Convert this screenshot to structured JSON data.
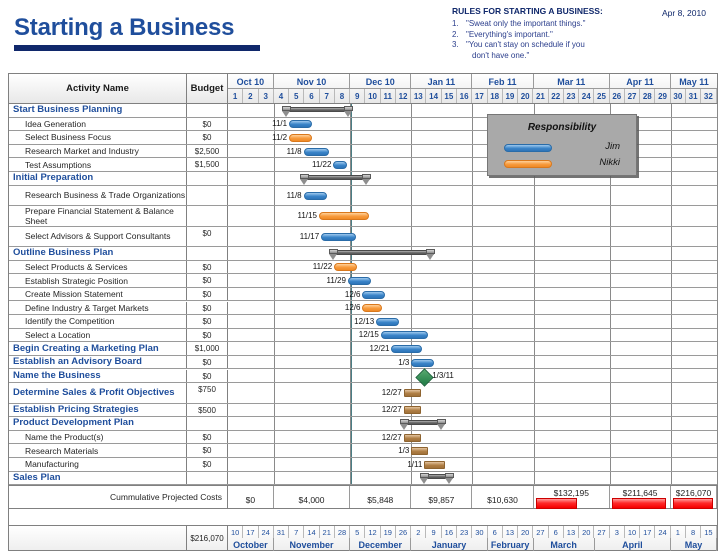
{
  "header": {
    "title": "Starting a Business",
    "date": "Apr 8, 2010",
    "rules_title": "RULES FOR STARTING A BUSINESS:",
    "rules": [
      {
        "num": "1.",
        "text": "\"Sweat only the important things.\"",
        "cont": ""
      },
      {
        "num": "2.",
        "text": "\"Everything's important.\"",
        "cont": ""
      },
      {
        "num": "3.",
        "text": "\"You can't stay on schedule if you",
        "cont": "don't have one.\""
      }
    ]
  },
  "columns": {
    "activity": "Activity Name",
    "budget": "Budget"
  },
  "timeline": {
    "months": [
      {
        "label": "Oct 10",
        "weeks": 3
      },
      {
        "label": "Nov 10",
        "weeks": 5
      },
      {
        "label": "Dec 10",
        "weeks": 4
      },
      {
        "label": "Jan 11",
        "weeks": 4
      },
      {
        "label": "Feb 11",
        "weeks": 4
      },
      {
        "label": "Mar 11",
        "weeks": 5
      },
      {
        "label": "Apr 11",
        "weeks": 4
      },
      {
        "label": "May 11",
        "weeks": 3
      }
    ],
    "week_numbers": [
      "1",
      "2",
      "3",
      "4",
      "5",
      "6",
      "7",
      "8",
      "9",
      "10",
      "11",
      "12",
      "13",
      "14",
      "15",
      "16",
      "17",
      "18",
      "19",
      "20",
      "21",
      "22",
      "23",
      "24",
      "25",
      "26",
      "27",
      "28",
      "29",
      "30",
      "31",
      "32"
    ]
  },
  "legend": {
    "title": "Responsibility",
    "items": [
      {
        "name": "Jim",
        "color": "#3a84c8",
        "key": "jim"
      },
      {
        "name": "Nikki",
        "color": "#f79a3c",
        "key": "nikki"
      }
    ]
  },
  "rows": [
    {
      "name": "Start Business Planning",
      "budget": "",
      "bold": true,
      "type": "summary",
      "start": 3.6,
      "end": 8.1
    },
    {
      "name": "Idea Generation",
      "budget": "$0",
      "bold": false,
      "type": "bar",
      "who": "jim",
      "label": "11/1",
      "start": 4.0,
      "end": 5.5
    },
    {
      "name": "Select Business Focus",
      "budget": "$0",
      "bold": false,
      "type": "bar",
      "who": "nikki",
      "label": "11/2",
      "start": 4.0,
      "end": 5.5
    },
    {
      "name": "Research Market and Industry",
      "budget": "$2,500",
      "bold": false,
      "type": "bar",
      "who": "jim",
      "label": "11/8",
      "start": 4.95,
      "end": 6.6
    },
    {
      "name": "Test Assumptions",
      "budget": "$1,500",
      "bold": false,
      "type": "bar",
      "who": "jim",
      "label": "11/22",
      "start": 6.9,
      "end": 7.8
    },
    {
      "name": "Initial Preparation",
      "budget": "",
      "bold": true,
      "type": "summary",
      "start": 4.75,
      "end": 9.3
    },
    {
      "name": "Research Business & Trade Organizations",
      "budget": "",
      "bold": false,
      "type": "bar",
      "who": "jim",
      "label": "11/8",
      "start": 4.95,
      "end": 6.5
    },
    {
      "name": "Prepare Financial Statement & Balance Sheet",
      "budget": "",
      "bold": false,
      "type": "bar",
      "who": "nikki",
      "label": "11/15",
      "start": 5.95,
      "end": 9.2
    },
    {
      "name": "Select Advisors & Support Consultants",
      "budget": "$0",
      "bold": false,
      "type": "bar",
      "who": "jim",
      "label": "11/17",
      "start": 6.1,
      "end": 8.35
    },
    {
      "name": "Outline Business Plan",
      "budget": "",
      "bold": true,
      "type": "summary",
      "start": 6.7,
      "end": 13.5
    },
    {
      "name": "Select Products & Services",
      "budget": "$0",
      "bold": false,
      "type": "bar",
      "who": "nikki",
      "label": "11/22",
      "start": 6.95,
      "end": 8.45
    },
    {
      "name": "Establish Strategic Position",
      "budget": "$0",
      "bold": false,
      "type": "bar",
      "who": "jim",
      "label": "11/29",
      "start": 7.85,
      "end": 9.35
    },
    {
      "name": "Create Mission Statement",
      "budget": "$0",
      "bold": false,
      "type": "bar",
      "who": "jim",
      "label": "12/6",
      "start": 8.8,
      "end": 10.3
    },
    {
      "name": "Define Industry & Target Markets",
      "budget": "$0",
      "bold": false,
      "type": "bar",
      "who": "nikki",
      "label": "12/6",
      "start": 8.8,
      "end": 10.1
    },
    {
      "name": "Identify the Competition",
      "budget": "$0",
      "bold": false,
      "type": "bar",
      "who": "jim",
      "label": "12/13",
      "start": 9.7,
      "end": 11.2
    },
    {
      "name": "Select a Location",
      "budget": "$0",
      "bold": false,
      "type": "bar",
      "who": "jim",
      "label": "12/15",
      "start": 10.0,
      "end": 13.1
    },
    {
      "name": "Begin Creating a Marketing Plan",
      "budget": "$1,000",
      "bold": true,
      "type": "bar",
      "who": "jim",
      "label": "12/21",
      "start": 10.7,
      "end": 12.7
    },
    {
      "name": "Establish an Advisory Board",
      "budget": "$0",
      "bold": true,
      "type": "bar",
      "who": "jim",
      "label": "1/3",
      "start": 12.0,
      "end": 13.5
    },
    {
      "name": "Name the Business",
      "budget": "$0",
      "bold": true,
      "type": "milestone",
      "label": "1/3/11",
      "start": 12.45
    },
    {
      "name": "Determine Sales & Profit Objectives",
      "budget": "$750",
      "bold": true,
      "type": "bar",
      "who": "none",
      "label": "12/27",
      "start": 11.5,
      "end": 12.6
    },
    {
      "name": "Establish Pricing Strategies",
      "budget": "$500",
      "bold": true,
      "type": "bar",
      "who": "none",
      "label": "12/27",
      "start": 11.5,
      "end": 12.6
    },
    {
      "name": "Product Development Plan",
      "budget": "",
      "bold": true,
      "type": "summary",
      "start": 11.3,
      "end": 14.2
    },
    {
      "name": "Name the Product(s)",
      "budget": "$0",
      "bold": false,
      "type": "bar",
      "who": "none",
      "label": "12/27",
      "start": 11.5,
      "end": 12.6
    },
    {
      "name": "Research Materials",
      "budget": "$0",
      "bold": false,
      "type": "bar",
      "who": "none",
      "label": "1/3",
      "start": 12.0,
      "end": 13.1
    },
    {
      "name": "Manufacturing",
      "budget": "$0",
      "bold": false,
      "type": "bar",
      "who": "none",
      "label": "1/11",
      "start": 12.85,
      "end": 14.2
    },
    {
      "name": "Sales Plan",
      "budget": "",
      "bold": true,
      "type": "summary",
      "start": 12.65,
      "end": 14.7
    }
  ],
  "costs": {
    "label": "Cummulative Projected Costs",
    "total": "$216,070",
    "values": [
      {
        "amount": "$0",
        "bar": false,
        "bar_pct": 0
      },
      {
        "amount": "$4,000",
        "bar": false,
        "bar_pct": 0
      },
      {
        "amount": "$5,848",
        "bar": false,
        "bar_pct": 0
      },
      {
        "amount": "$9,857",
        "bar": false,
        "bar_pct": 0
      },
      {
        "amount": "$10,630",
        "bar": false,
        "bar_pct": 0
      },
      {
        "amount": "$132,195",
        "bar": true,
        "bar_pct": 61
      },
      {
        "amount": "$211,645",
        "bar": true,
        "bar_pct": 98
      },
      {
        "amount": "$216,070",
        "bar": true,
        "bar_pct": 100
      }
    ]
  },
  "footer": {
    "total": "$216,070",
    "week_days": [
      "10",
      "17",
      "24",
      "31",
      "7",
      "14",
      "21",
      "28",
      "5",
      "12",
      "19",
      "26",
      "2",
      "9",
      "16",
      "23",
      "30",
      "6",
      "13",
      "20",
      "27",
      "6",
      "13",
      "20",
      "27",
      "3",
      "10",
      "17",
      "24",
      "1",
      "8",
      "15"
    ],
    "months": [
      {
        "label": "October",
        "weeks": 3
      },
      {
        "label": "November",
        "weeks": 5
      },
      {
        "label": "December",
        "weeks": 4
      },
      {
        "label": "January",
        "weeks": 5
      },
      {
        "label": "February",
        "weeks": 3
      },
      {
        "label": "March",
        "weeks": 4
      },
      {
        "label": "April",
        "weeks": 5
      },
      {
        "label": "May",
        "weeks": 3
      }
    ]
  }
}
